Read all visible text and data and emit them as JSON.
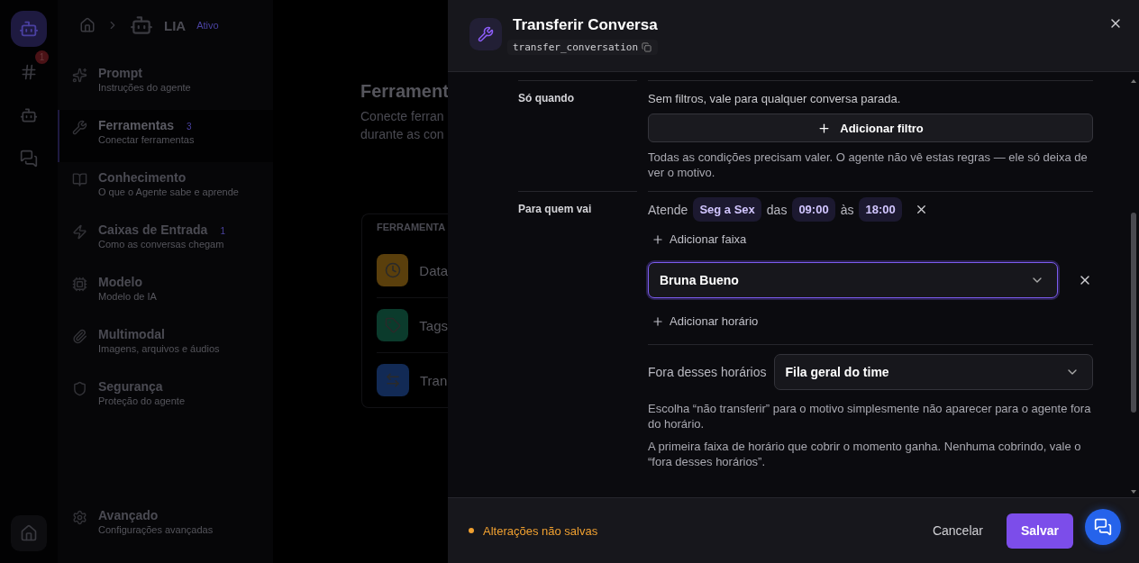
{
  "rail": {
    "items": [
      {
        "kind": "channels",
        "badge": "1",
        "selected": false
      },
      {
        "kind": "agents",
        "selected": false
      },
      {
        "kind": "conversations",
        "selected": false
      }
    ],
    "footer": {
      "kind": "home",
      "selected": true
    }
  },
  "breadcrumb": {
    "agent": "LIA",
    "status": "Ativo"
  },
  "nav": {
    "items": [
      {
        "title": "Prompt",
        "subtitle": "Instruções do agente",
        "selected": false
      },
      {
        "title": "Ferramentas",
        "count": "3",
        "subtitle": "Conectar ferramentas",
        "selected": true
      },
      {
        "title": "Conhecimento",
        "subtitle": "O que o Agente sabe e aprende",
        "selected": false
      },
      {
        "title": "Caixas de Entrada",
        "count": "1",
        "subtitle": "Como as conversas chegam",
        "selected": false
      },
      {
        "title": "Modelo",
        "subtitle": "Modelo de IA",
        "selected": false
      },
      {
        "title": "Multimodal",
        "subtitle": "Imagens, arquivos e áudios",
        "selected": false
      },
      {
        "title": "Segurança",
        "subtitle": "Proteção do agente",
        "selected": false
      }
    ],
    "footer": {
      "title": "Avançado",
      "subtitle": "Configurações avançadas",
      "selected": false
    }
  },
  "main": {
    "title": "Ferrament",
    "description": [
      "Conecte ferran",
      "durante as con"
    ],
    "tools_card": {
      "header": "FERRAMENTA",
      "tools": [
        {
          "name": "Data",
          "color": "#5a3f0c"
        },
        {
          "name": "Tags",
          "color": "#0b3b2c"
        },
        {
          "name": "Tran",
          "color": "#122a55"
        }
      ]
    }
  },
  "drawer": {
    "title": "Transferir Conversa",
    "code": "transfer_conversation",
    "sections": [
      {
        "kind": "filters",
        "label": "Só quando",
        "text": "Sem filtros, vale para qualquer conversa parada.",
        "button": "Adicionar filtro",
        "help": "Todas as condições precisam valer. O agente não vê estas regras — ele só deixa de ver o motivo."
      },
      {
        "kind": "routing",
        "label": "Para quem vai",
        "schedule": {
          "prefix": "Atende",
          "days": "Seg a Sex",
          "from_label": "das",
          "from": "09:00",
          "to_label": "às",
          "to": "18:00"
        },
        "add_range": "Adicionar faixa",
        "assignee": {
          "value": "Bruna Bueno",
          "focused": true
        },
        "add_schedule": "Adicionar horário",
        "fallback": {
          "label": "Fora desses horários",
          "value": "Fila geral do time"
        },
        "notes": [
          "Escolha “não transferir” para o motivo simplesmente não aparecer para o agente fora do horário.",
          "A primeira faixa de horário que cobrir o momento ganha. Nenhuma cobrindo, vale o “fora desses horários”."
        ]
      }
    ]
  },
  "footer": {
    "status": "Alterações não salvas",
    "cancel": "Cancelar",
    "save": "Salvar"
  }
}
